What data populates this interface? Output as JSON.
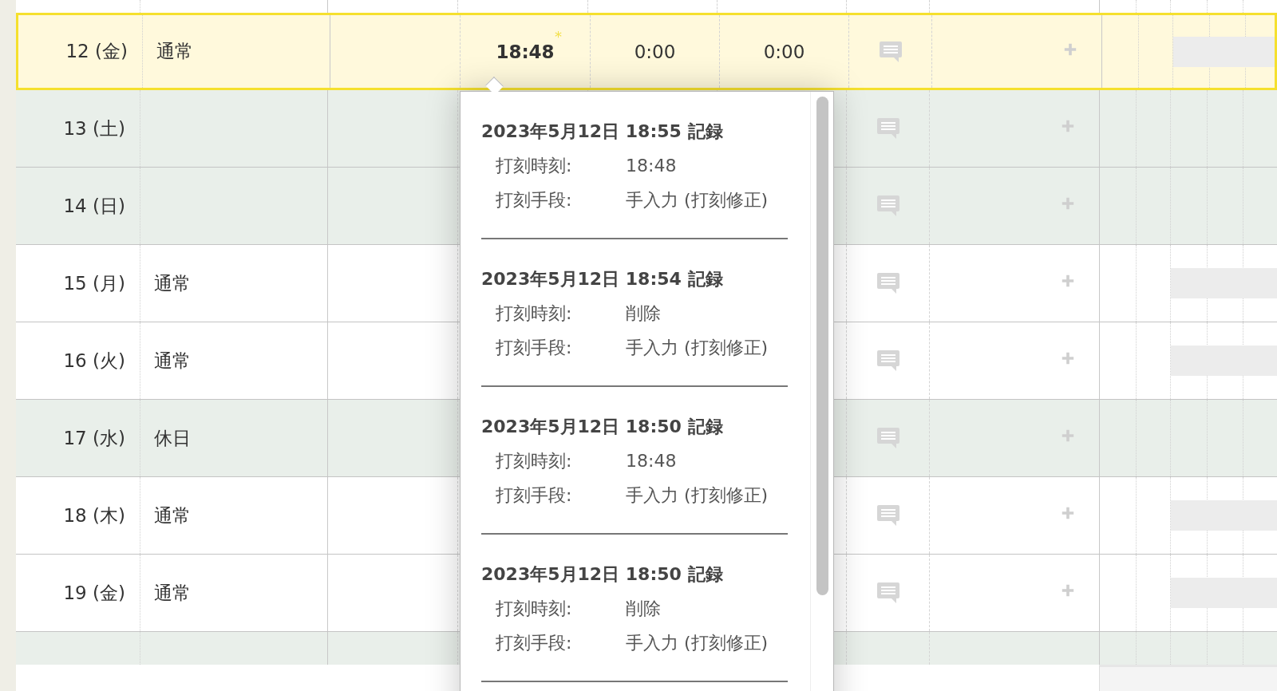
{
  "rows": [
    {
      "day": "12 (金)",
      "type": "通常",
      "kind": "workday",
      "selected": true,
      "clock_out": "18:48",
      "edited_mark": "*",
      "column_5": "0:00",
      "column_6": "0:00"
    },
    {
      "day": "13 (土)",
      "kind": "holiday",
      "selected": false
    },
    {
      "day": "14 (日)",
      "kind": "holiday",
      "selected": false
    },
    {
      "day": "15 (月)",
      "type": "通常",
      "kind": "workday",
      "selected": false
    },
    {
      "day": "16 (火)",
      "type": "通常",
      "kind": "workday",
      "selected": false
    },
    {
      "day": "17 (水)",
      "type": "休日",
      "kind": "holiday",
      "selected": false
    },
    {
      "day": "18 (木)",
      "type": "通常",
      "kind": "workday",
      "selected": false
    },
    {
      "day": "19 (金)",
      "type": "通常",
      "kind": "workday",
      "selected": false
    },
    {
      "kind": "holiday",
      "selected": false
    }
  ],
  "history_popup": {
    "entries": [
      {
        "heading": "2023年5月12日 18:55 記録",
        "fields": [
          {
            "label": "打刻時刻:",
            "value": "18:48"
          },
          {
            "label": "打刻手段:",
            "value": "手入力 (打刻修正)"
          }
        ]
      },
      {
        "heading": "2023年5月12日 18:54 記録",
        "fields": [
          {
            "label": "打刻時刻:",
            "value": "削除"
          },
          {
            "label": "打刻手段:",
            "value": "手入力 (打刻修正)"
          }
        ]
      },
      {
        "heading": "2023年5月12日 18:50 記録",
        "fields": [
          {
            "label": "打刻時刻:",
            "value": "18:48"
          },
          {
            "label": "打刻手段:",
            "value": "手入力 (打刻修正)"
          }
        ]
      },
      {
        "heading": "2023年5月12日 18:50 記録",
        "fields": [
          {
            "label": "打刻時刻:",
            "value": "削除"
          },
          {
            "label": "打刻手段:",
            "value": "手入力 (打刻修正)"
          }
        ]
      }
    ]
  }
}
